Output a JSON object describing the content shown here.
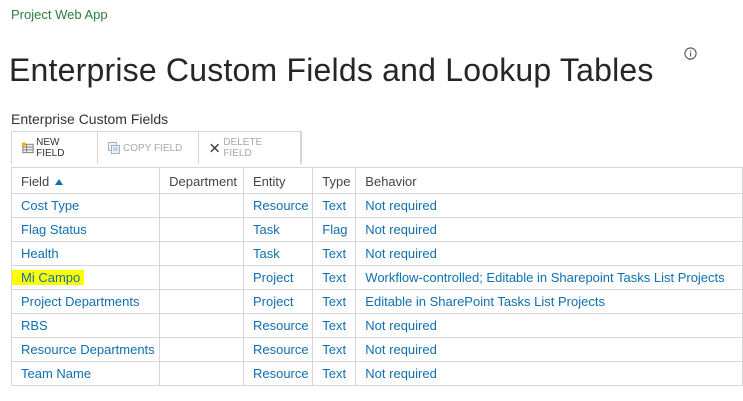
{
  "app": {
    "name": "Project Web App"
  },
  "page": {
    "title": "Enterprise Custom Fields and Lookup Tables"
  },
  "section": {
    "title": "Enterprise Custom Fields"
  },
  "toolbar": {
    "new_label": "New Field",
    "copy_label": "Copy Field",
    "delete_label": "Delete Field"
  },
  "table": {
    "headers": {
      "field": "Field",
      "department": "Department",
      "entity": "Entity",
      "type": "Type",
      "behavior": "Behavior"
    },
    "rows": [
      {
        "field": "Cost Type",
        "department": "",
        "entity": "Resource",
        "type": "Text",
        "behavior": "Not required"
      },
      {
        "field": "Flag Status",
        "department": "",
        "entity": "Task",
        "type": "Flag",
        "behavior": "Not required"
      },
      {
        "field": "Health",
        "department": "",
        "entity": "Task",
        "type": "Text",
        "behavior": "Not required"
      },
      {
        "field": "Mi Campo",
        "department": "",
        "entity": "Project",
        "type": "Text",
        "behavior": "Workflow-controlled; Editable in Sharepoint Tasks List Projects"
      },
      {
        "field": "Project Departments",
        "department": "",
        "entity": "Project",
        "type": "Text",
        "behavior": "Editable in SharePoint Tasks List Projects"
      },
      {
        "field": "RBS",
        "department": "",
        "entity": "Resource",
        "type": "Text",
        "behavior": "Not required"
      },
      {
        "field": "Resource Departments",
        "department": "",
        "entity": "Resource",
        "type": "Text",
        "behavior": "Not required"
      },
      {
        "field": "Team Name",
        "department": "",
        "entity": "Resource",
        "type": "Text",
        "behavior": "Not required"
      }
    ]
  },
  "colors": {
    "link": "#0f6fb0",
    "app": "#2b7e3e",
    "highlight": "#ffff00",
    "border": "#d6d6d6"
  }
}
